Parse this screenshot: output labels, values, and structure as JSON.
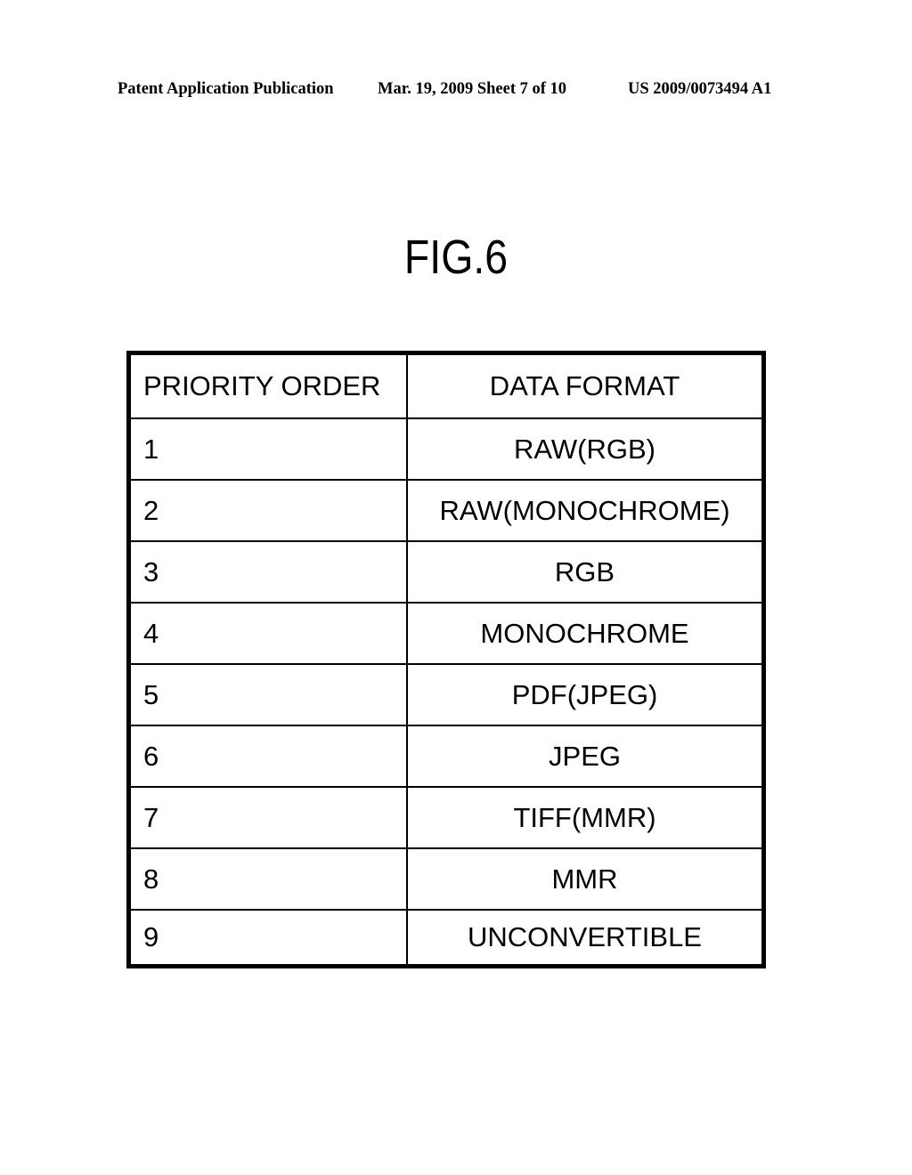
{
  "header": {
    "publication": "Patent Application Publication",
    "date_sheet": "Mar. 19, 2009  Sheet 7 of 10",
    "patent_number": "US 2009/0073494 A1"
  },
  "figure": {
    "title": "FIG.6"
  },
  "table": {
    "columns": [
      "PRIORITY ORDER",
      "DATA FORMAT"
    ],
    "rows": [
      {
        "priority": "1",
        "format": "RAW(RGB)"
      },
      {
        "priority": "2",
        "format": "RAW(MONOCHROME)"
      },
      {
        "priority": "3",
        "format": "RGB"
      },
      {
        "priority": "4",
        "format": "MONOCHROME"
      },
      {
        "priority": "5",
        "format": "PDF(JPEG)"
      },
      {
        "priority": "6",
        "format": "JPEG"
      },
      {
        "priority": "7",
        "format": "TIFF(MMR)"
      },
      {
        "priority": "8",
        "format": "MMR"
      },
      {
        "priority": "9",
        "format": "UNCONVERTIBLE"
      }
    ]
  }
}
